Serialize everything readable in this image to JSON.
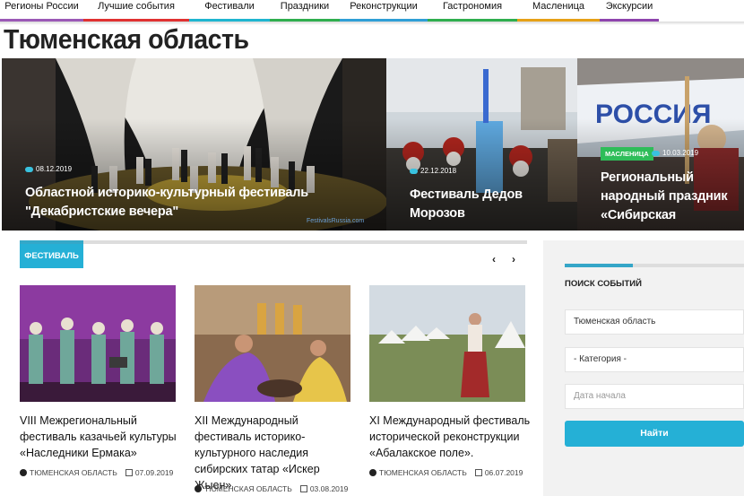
{
  "nav": [
    {
      "label": "Регионы России",
      "color": "#9b59b6"
    },
    {
      "label": "Лучшие события",
      "color": "#e03131"
    },
    {
      "label": "Фестивали",
      "color": "#1fb5d0"
    },
    {
      "label": "Праздники",
      "color": "#2fae4e"
    },
    {
      "label": "Реконструкции",
      "color": "#2f9fd6"
    },
    {
      "label": "Гастрономия",
      "color": "#2fae4e"
    },
    {
      "label": "Масленица",
      "color": "#e6a117"
    },
    {
      "label": "Экскурсии",
      "color": "#8e44ad"
    }
  ],
  "page": {
    "title": "Тюменская область"
  },
  "hero": [
    {
      "date": "08.12.2019",
      "title": "Областной историко-культурный фестиваль \"Декабристские вечера\"",
      "watermark": "FestivalsRussia.com"
    },
    {
      "date": "22.12.2018",
      "title": "Фестиваль Дедов Морозов"
    },
    {
      "badge": "МАСЛЕНИЦА",
      "date": "10.03.2019",
      "title": "Региональный народный праздник «Сибирская масленица»"
    }
  ],
  "section": {
    "tag": "ФЕСТИВАЛЬ",
    "prev": "‹",
    "next": "›"
  },
  "cards": [
    {
      "title": "VIII Межрегиональный фестиваль казачьей культуры «Наследники Ермака»",
      "region": "ТЮМЕНСКАЯ ОБЛАСТЬ",
      "date": "07.09.2019"
    },
    {
      "title": "XII Международный фестиваль историко-культурного наследия сибирских татар «Искер Жыен»",
      "region": "ТЮМЕНСКАЯ ОБЛАСТЬ",
      "date": "03.08.2019"
    },
    {
      "title": "XI Международный фестиваль исторической реконструкции «Абалакское поле».",
      "region": "ТЮМЕНСКАЯ ОБЛАСТЬ",
      "date": "06.07.2019"
    }
  ],
  "sidebar": {
    "title": "ПОИСК СОБЫТИЙ",
    "region_value": "Тюменская область",
    "category_value": "- Категория -",
    "date_placeholder": "Дата начала",
    "button": "Найти"
  },
  "colors": {
    "accent": "#25b0d6",
    "badge": "#2ebd59"
  }
}
